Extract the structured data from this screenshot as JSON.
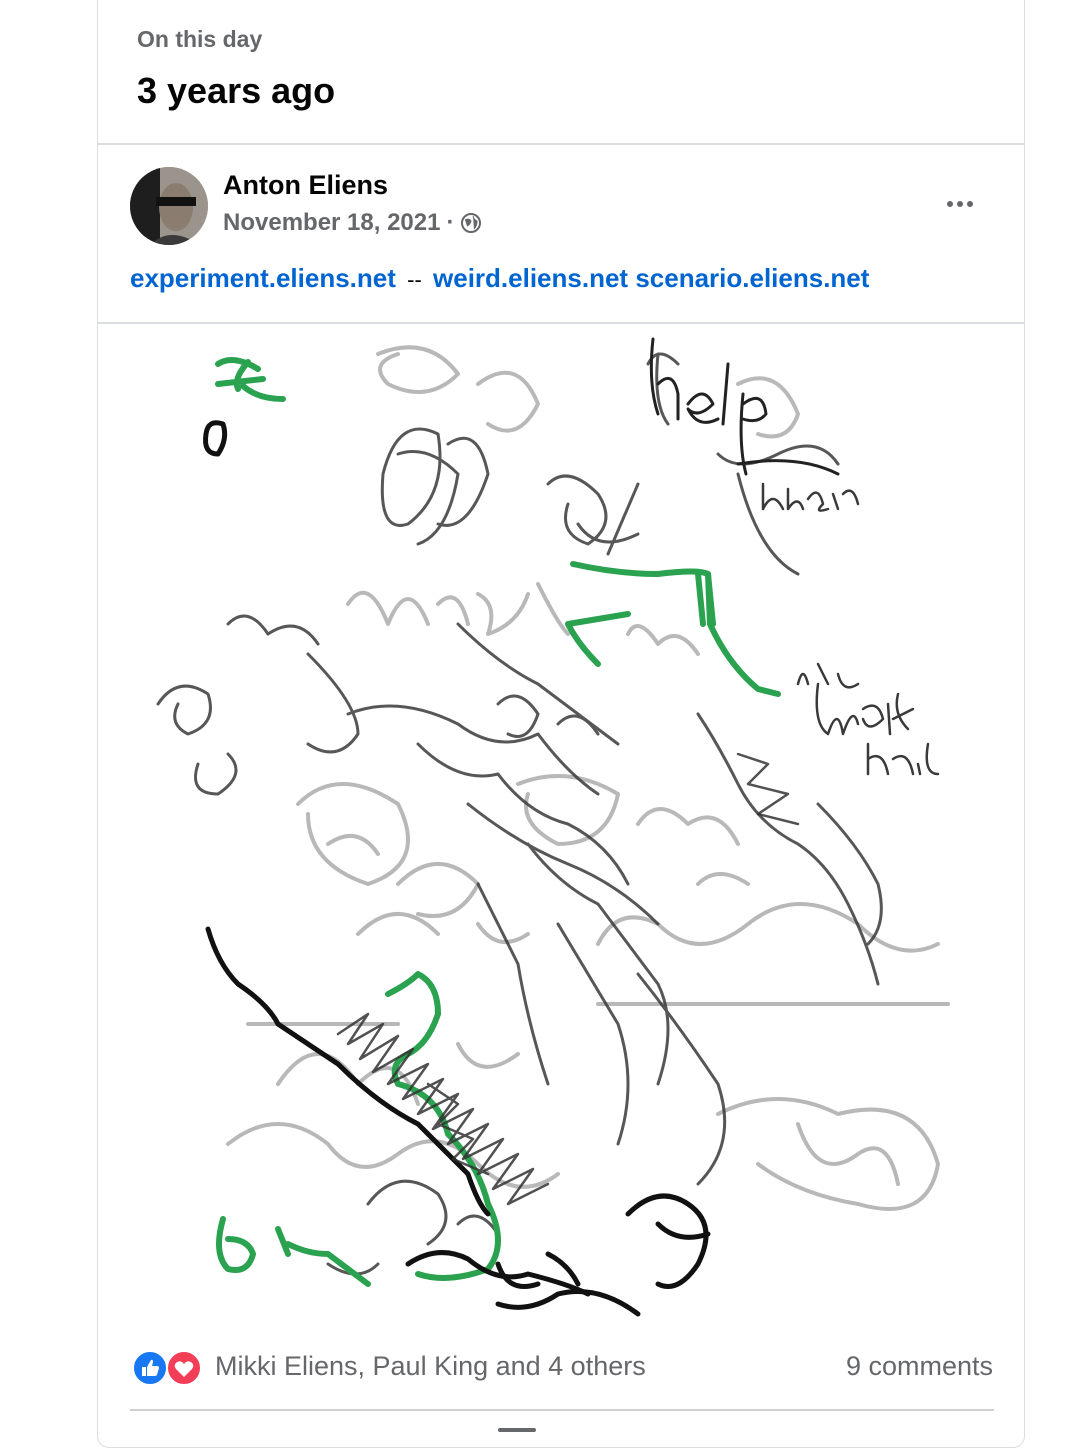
{
  "memory": {
    "label": "On this day",
    "period": "3 years ago"
  },
  "post": {
    "author": "Anton Eliens",
    "date": "November 18, 2021",
    "separator": "·",
    "privacy_icon": "globe-icon",
    "more_icon": "more-options-icon",
    "links": {
      "link1": "experiment.eliens.net",
      "sep": "--",
      "link2": "weird.eliens.net",
      "link3": "scenario.eliens.net"
    },
    "image": "sketch-drawing"
  },
  "reactions": {
    "icons": [
      "like-icon",
      "love-icon"
    ],
    "names": "Mikki Eliens, Paul King and 4 others",
    "comments": "9 comments"
  },
  "colors": {
    "link": "#0064d1",
    "secondary": "#65676b",
    "like": "#1877f2",
    "love": "#f33e58"
  }
}
